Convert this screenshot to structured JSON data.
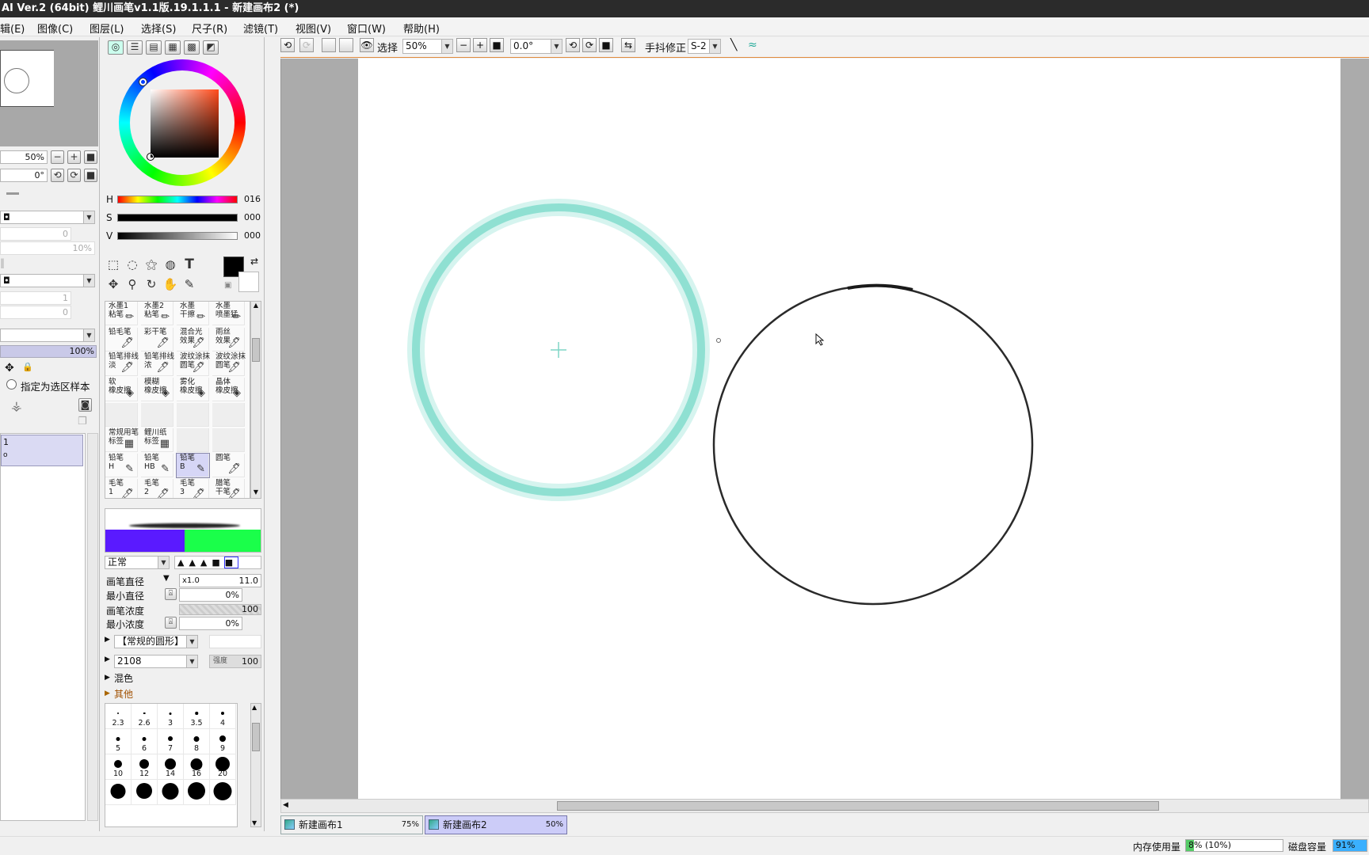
{
  "window": {
    "title": "AI Ver.2 (64bit) 鲤川画笔v1.1版.19.1.1.1 - 新建画布2 (*)"
  },
  "menu": [
    {
      "label": "辑(E)"
    },
    {
      "label": "图像(C)"
    },
    {
      "label": "图层(L)"
    },
    {
      "label": "选择(S)"
    },
    {
      "label": "尺子(R)"
    },
    {
      "label": "滤镜(T)"
    },
    {
      "label": "视图(V)"
    },
    {
      "label": "窗口(W)"
    },
    {
      "label": "帮助(H)"
    }
  ],
  "navigator": {
    "zoom": "50%",
    "angle": "0°"
  },
  "layer_panel": {
    "value_0a": "0",
    "value_10": "10%",
    "value_1": "1",
    "value_0b": "0",
    "opacity": "100%",
    "selection_sample_label": "指定为选区样本",
    "layer_item_1": "1",
    "layer_item_2": "o"
  },
  "color": {
    "h_label": "H",
    "h_value": "016",
    "s_label": "S",
    "s_value": "000",
    "v_label": "V",
    "v_value": "000",
    "fg": "#000000",
    "bg": "#ffffff"
  },
  "brushes": [
    {
      "name": "水墨1\n粘笔",
      "icon": "brush-icon"
    },
    {
      "name": "水墨2\n粘笔",
      "icon": "brush-icon"
    },
    {
      "name": "水墨\n干擦",
      "icon": "brush-icon"
    },
    {
      "name": "水墨\n喷墨猛",
      "icon": "brush-icon"
    },
    {
      "name": "铅毛笔",
      "icon": "pen-icon"
    },
    {
      "name": "彩干笔",
      "icon": "pen-icon"
    },
    {
      "name": "混合光\n效果",
      "icon": "pen-icon"
    },
    {
      "name": "雨丝\n效果",
      "icon": "pen-icon"
    },
    {
      "name": "铅笔排线\n淡",
      "icon": "pen-icon"
    },
    {
      "name": "铅笔排线\n浓",
      "icon": "pen-icon"
    },
    {
      "name": "波纹涂抹\n圆笔",
      "icon": "pen-icon"
    },
    {
      "name": "波纹涂抹\n圆笔",
      "icon": "pen-icon"
    },
    {
      "name": "软\n橡皮擦",
      "icon": "eraser-icon"
    },
    {
      "name": "模糊\n橡皮擦",
      "icon": "eraser-icon"
    },
    {
      "name": "雾化\n橡皮擦",
      "icon": "eraser-icon"
    },
    {
      "name": "晶体\n橡皮擦",
      "icon": "eraser-icon"
    },
    {
      "name": "常规用笔\n标签",
      "icon": "gradient-icon"
    },
    {
      "name": "鲤川纸\n标签",
      "icon": "gradient-icon"
    },
    {
      "name": "铅笔\nH",
      "icon": "pencil-icon"
    },
    {
      "name": "铅笔\nHB",
      "icon": "pencil-icon"
    },
    {
      "name": "铅笔\nB",
      "icon": "pencil-icon"
    },
    {
      "name": "圆笔",
      "icon": "pen-icon"
    },
    {
      "name": "毛笔\n1",
      "icon": "pen-icon"
    },
    {
      "name": "毛笔\n2",
      "icon": "pen-icon"
    },
    {
      "name": "毛笔\n3",
      "icon": "pen-icon"
    },
    {
      "name": "腊笔\n干笔",
      "icon": "pen-icon"
    }
  ],
  "brush_settings": {
    "blend_mode": "正常",
    "size_label": "画笔直径",
    "size_mult": "x1.0",
    "size_value": "11.0",
    "min_size_label": "最小直径",
    "min_size_value": "0%",
    "density_label": "画笔浓度",
    "density_value": "100",
    "min_density_label": "最小浓度",
    "min_density_value": "0%",
    "shape": "【常规的圆形】",
    "texture": "2108",
    "strength_label": "强度",
    "strength_value": "100",
    "mix_label": "混色",
    "other_label": "其他"
  },
  "brush_sizes": [
    "2.3",
    "2.6",
    "3",
    "3.5",
    "4",
    "5",
    "6",
    "7",
    "8",
    "9",
    "10",
    "12",
    "14",
    "16",
    "20"
  ],
  "toolbar": {
    "select_label": "选择",
    "zoom": "50%",
    "angle": "0.0°",
    "stabilizer_label": "手抖修正",
    "stabilizer_value": "S-2"
  },
  "documents": [
    {
      "name": "新建画布1",
      "zoom": "75%"
    },
    {
      "name": "新建画布2",
      "zoom": "50%"
    }
  ],
  "status": {
    "memory_label": "内存使用量",
    "memory_value": "8% (10%)",
    "disk_label": "磁盘容量",
    "disk_value": "91%"
  },
  "canvas": {
    "stroke_color": "#7fdccd",
    "circle_color": "#2a2a2a"
  }
}
